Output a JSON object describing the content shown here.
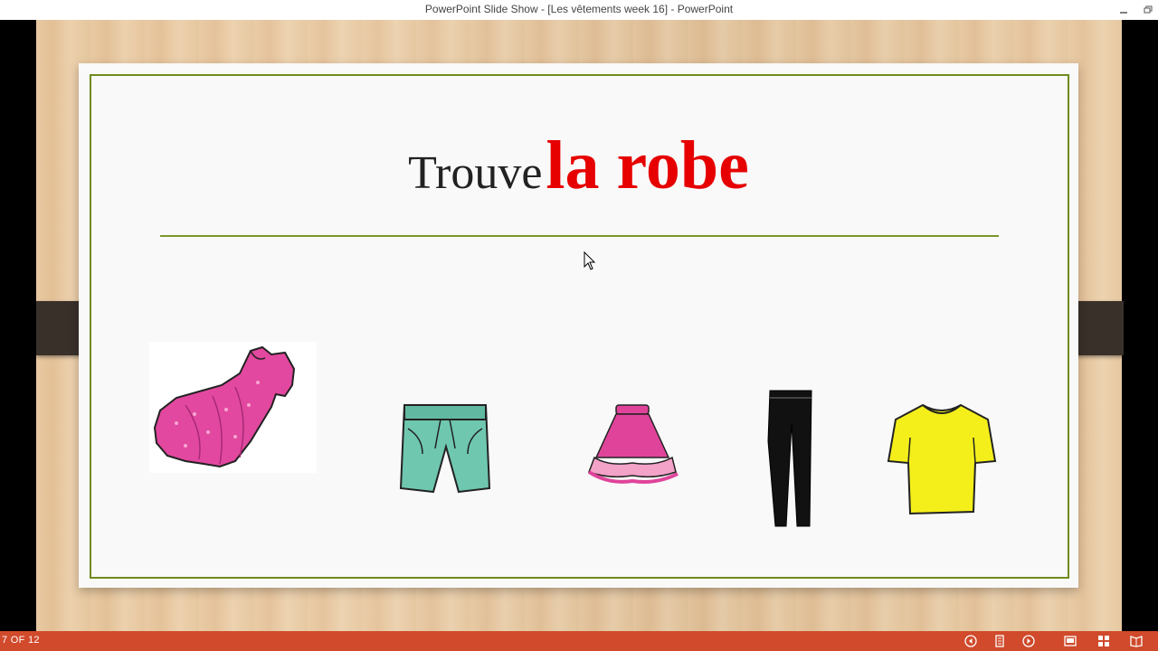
{
  "window": {
    "title": "PowerPoint Slide Show - [Les vêtements week 16] - PowerPoint",
    "minimize_icon": "minimize-icon",
    "restore_icon": "restore-icon"
  },
  "slide": {
    "heading_prefix": "Trouve",
    "heading_target": "la robe",
    "heading_target_color": "#e60000",
    "frame_color": "#6e8b1f",
    "items": [
      {
        "name": "dress",
        "color": "#e2489f"
      },
      {
        "name": "shorts",
        "color": "#6fc7b0"
      },
      {
        "name": "skirt",
        "color": "#e0449a"
      },
      {
        "name": "trousers",
        "color": "#111111"
      },
      {
        "name": "t-shirt",
        "color": "#f4ef1a"
      }
    ]
  },
  "statusbar": {
    "slide_count": "7 OF 12",
    "color": "#d04a2b",
    "buttons": [
      "previous-icon",
      "notes-icon",
      "next-icon",
      "normal-view-icon",
      "slide-sorter-icon",
      "reading-view-icon"
    ]
  }
}
